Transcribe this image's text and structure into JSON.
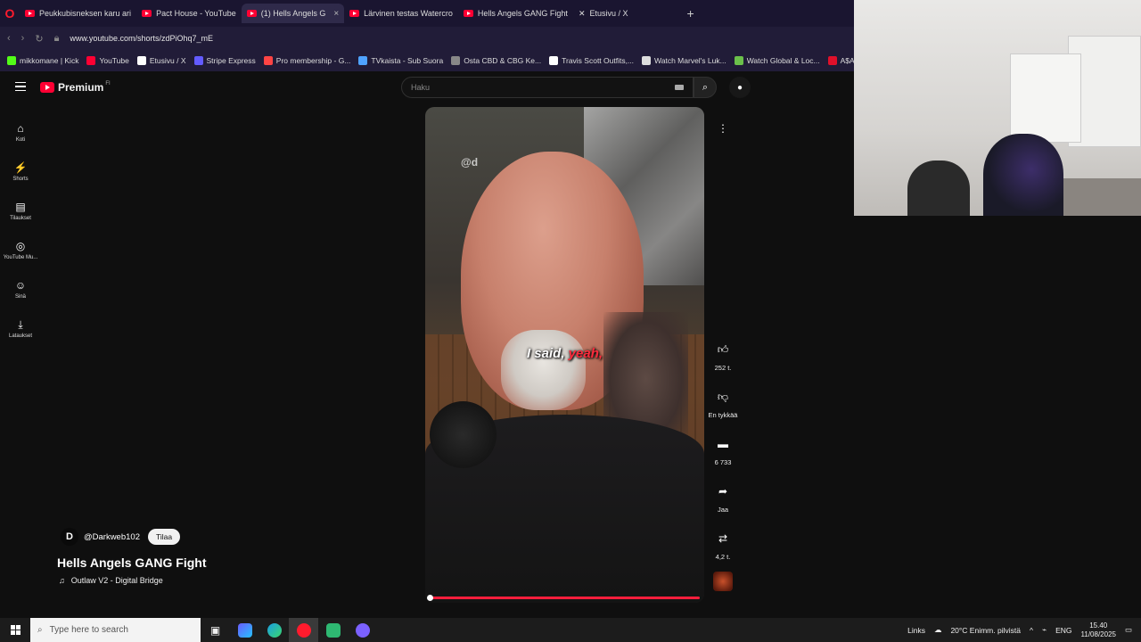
{
  "browser": {
    "tabs": [
      {
        "label": "Peukkubisneksen karu ari",
        "active": false
      },
      {
        "label": "Pact House - YouTube",
        "active": false
      },
      {
        "label": "(1) Hells Angels G",
        "active": true
      },
      {
        "label": "Lärvinen testas Watercro",
        "active": false
      },
      {
        "label": "Hells Angels GANG Fight",
        "active": false
      },
      {
        "label": "Etusivu / X",
        "active": false
      }
    ],
    "url": "www.youtube.com/shorts/zdPiOhq7_mE",
    "bookmarks": [
      {
        "label": "mikkomane | Kick",
        "color": "#53fc18"
      },
      {
        "label": "YouTube",
        "color": "#ff0033"
      },
      {
        "label": "Etusivu / X",
        "color": "#ffffff"
      },
      {
        "label": "Stripe Express",
        "color": "#635bff"
      },
      {
        "label": "Pro membership - G...",
        "color": "#ff4444"
      },
      {
        "label": "TVkaista - Sub Suora",
        "color": "#4fa3ff"
      },
      {
        "label": "Osta CBD & CBG Ke...",
        "color": "#888888"
      },
      {
        "label": "Travis Scott Outfits,...",
        "color": "#ffffff"
      },
      {
        "label": "Watch Marvel's Luk...",
        "color": "#dddddd"
      },
      {
        "label": "Watch Global & Loc...",
        "color": "#6bc04b"
      },
      {
        "label": "A$AP ROCKY x PU...",
        "color": "#e0102a"
      }
    ]
  },
  "yt": {
    "logo": "Premium",
    "logo_sup": "FI",
    "search_placeholder": "Haku",
    "guide": [
      {
        "label": "Koti",
        "icon": "home-icon",
        "glyph": "⌂"
      },
      {
        "label": "Shorts",
        "icon": "shorts-icon",
        "glyph": "⚡"
      },
      {
        "label": "Tilaukset",
        "icon": "subscriptions-icon",
        "glyph": "▤"
      },
      {
        "label": "YouTube Mu...",
        "icon": "music-icon",
        "glyph": "◎"
      },
      {
        "label": "Sinä",
        "icon": "you-icon",
        "glyph": "☺"
      },
      {
        "label": "Lataukset",
        "icon": "download-icon",
        "glyph": "⤓"
      }
    ]
  },
  "video": {
    "watermark": "@d",
    "caption_word1": "I said,",
    "caption_word2": "yeah,",
    "progress": 1.0
  },
  "actions": {
    "like_count": "252 t.",
    "dislike_label": "En tykkää",
    "comment_count": "6 733",
    "share_label": "Jaa",
    "remix_count": "4,2 t."
  },
  "channel": {
    "avatar_letter": "D",
    "handle": "@Darkweb102",
    "subscribe_label": "Tilaa"
  },
  "title": "Hells Angels GANG Fight",
  "music": {
    "icon": "♫",
    "track": "Outlaw V2 - Digital Bridge"
  },
  "taskbar": {
    "search_placeholder": "Type here to search",
    "links_label": "Links",
    "weather": "20°C  Enimm. pilvistä",
    "lang": "ENG",
    "time": "15.40",
    "date": "11/08/2025"
  }
}
